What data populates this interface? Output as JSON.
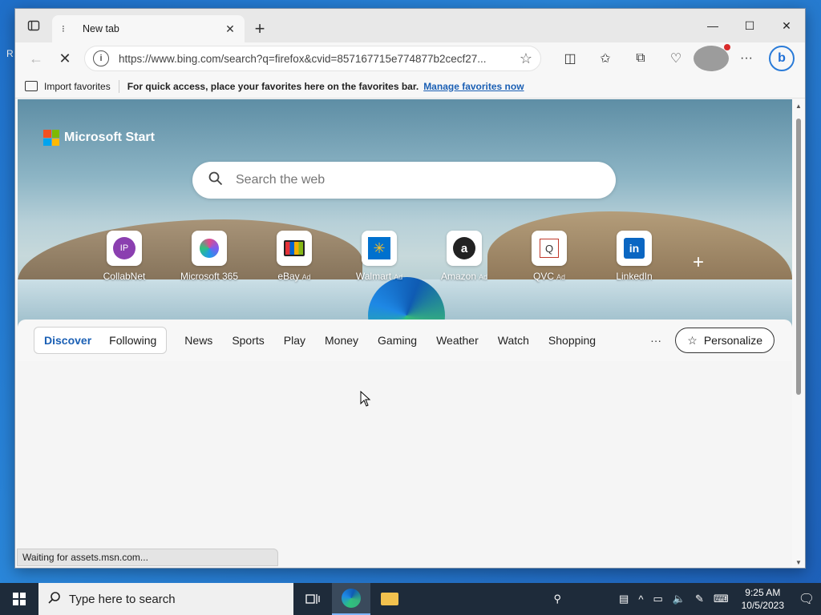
{
  "browser": {
    "tab_title": "New tab",
    "new_tab_symbol": "+",
    "url": "https://www.bing.com/search?q=firefox&cvid=857167715e774877b2cecf27...",
    "favorites_bar": {
      "import_label": "Import favorites",
      "tip": "For quick access, place your favorites here on the favorites bar.",
      "manage_link": "Manage favorites now"
    }
  },
  "newtab": {
    "brand": "Microsoft Start",
    "search_placeholder": "Search the web",
    "tiles": [
      {
        "label": "CollabNet",
        "ad": "",
        "icon_text": "IP"
      },
      {
        "label": "Microsoft 365",
        "ad": "",
        "icon_text": ""
      },
      {
        "label": "eBay",
        "ad": "Ad",
        "icon_text": ""
      },
      {
        "label": "Walmart",
        "ad": "Ad",
        "icon_text": ""
      },
      {
        "label": "Amazon",
        "ad": "Ad",
        "icon_text": "a"
      },
      {
        "label": "QVC",
        "ad": "Ad",
        "icon_text": "Q"
      },
      {
        "label": "LinkedIn",
        "ad": "",
        "icon_text": "in"
      }
    ],
    "feed_tabs": {
      "active": "Discover",
      "following": "Following",
      "links": [
        "News",
        "Sports",
        "Play",
        "Money",
        "Gaming",
        "Weather",
        "Watch",
        "Shopping"
      ],
      "more": "···",
      "personalize": "Personalize"
    }
  },
  "status_bar": "Waiting for assets.msn.com...",
  "taskbar": {
    "search_placeholder": "Type here to search",
    "time": "9:25 AM",
    "date": "10/5/2023"
  }
}
